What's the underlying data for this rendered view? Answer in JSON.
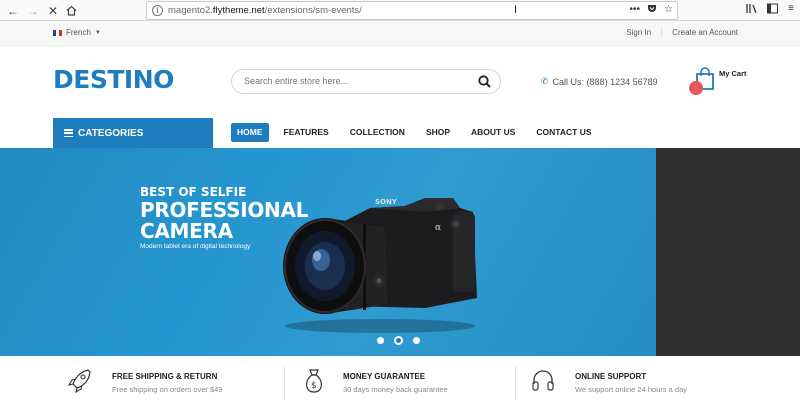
{
  "browser": {
    "url_prefix": "magento2.",
    "url_domain": "flytheme.net",
    "url_path": "/extensions/sm-events/",
    "cursor": "I"
  },
  "top": {
    "language": "French",
    "sign_in": "Sign In",
    "create_account": "Create an Account"
  },
  "header": {
    "logo": "DESTINO",
    "search_placeholder": "Search entire store here...",
    "call_us": "Call Us: (888) 1234 56789",
    "cart_label": "My Cart"
  },
  "nav": {
    "categories": "CATEGORIES",
    "items": [
      "HOME",
      "FEATURES",
      "COLLECTION",
      "SHOP",
      "ABOUT US",
      "CONTACT US"
    ],
    "active": "HOME"
  },
  "hero": {
    "subtitle": "BEST OF SELFIE",
    "title": "PROFESSIONAL CAMERA",
    "caption": "Modern tablet era of digital technology",
    "camera_brand": "SONY",
    "camera_model": "α"
  },
  "features": [
    {
      "title": "FREE SHIPPING & RETURN",
      "desc": "Free shipping on orders over $49",
      "icon": "rocket-icon"
    },
    {
      "title": "MONEY GUARANTEE",
      "desc": "30 days money back guarantee",
      "icon": "money-bag-icon"
    },
    {
      "title": "ONLINE SUPPORT",
      "desc": "We support online 24 hours a day",
      "icon": "headphones-icon"
    }
  ],
  "colors": {
    "brand": "#1d7dbf",
    "hero_bg": "#2596cf",
    "badge": "#e05a5a"
  }
}
